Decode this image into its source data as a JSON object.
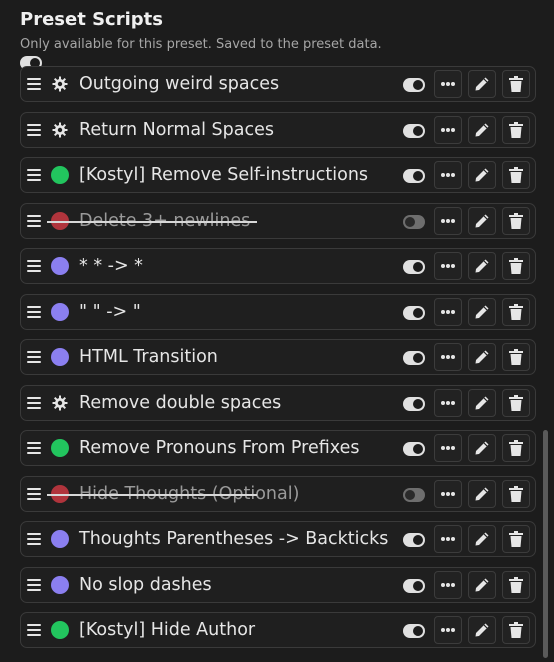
{
  "header": {
    "title": "Preset Scripts",
    "subtitle": "Only available for this preset. Saved to the preset data.",
    "master_enabled": true
  },
  "colors": {
    "green": "#22c55e",
    "red": "#b0343c",
    "purple": "#8b7ff0"
  },
  "scripts": [
    {
      "label": "Outgoing weird spaces",
      "status_icon": "gear-icon",
      "enabled": true,
      "disabled": false
    },
    {
      "label": "Return Normal Spaces",
      "status_icon": "gear-icon",
      "enabled": true,
      "disabled": false
    },
    {
      "label": "[Kostyl] Remove Self-instructions",
      "status_icon": "green-dot",
      "enabled": true,
      "disabled": false
    },
    {
      "label": "Delete 3+ newlines",
      "status_icon": "red-dot",
      "enabled": false,
      "disabled": true
    },
    {
      "label": "* * -> *",
      "status_icon": "purple-dot",
      "enabled": true,
      "disabled": false
    },
    {
      "label": "\" \" -> \"",
      "status_icon": "purple-dot",
      "enabled": true,
      "disabled": false
    },
    {
      "label": "HTML Transition",
      "status_icon": "purple-dot",
      "enabled": true,
      "disabled": false
    },
    {
      "label": "Remove double spaces",
      "status_icon": "gear-icon",
      "enabled": true,
      "disabled": false
    },
    {
      "label": "Remove Pronouns From Prefixes",
      "status_icon": "green-dot",
      "enabled": true,
      "disabled": false
    },
    {
      "label": "Hide Thoughts (Optional)",
      "status_icon": "red-dot",
      "enabled": false,
      "disabled": true
    },
    {
      "label": "Thoughts Parentheses -> Backticks",
      "status_icon": "purple-dot",
      "enabled": true,
      "disabled": false
    },
    {
      "label": "No slop dashes",
      "status_icon": "purple-dot",
      "enabled": true,
      "disabled": false
    },
    {
      "label": "[Kostyl] Hide Author",
      "status_icon": "green-dot",
      "enabled": true,
      "disabled": false
    }
  ]
}
